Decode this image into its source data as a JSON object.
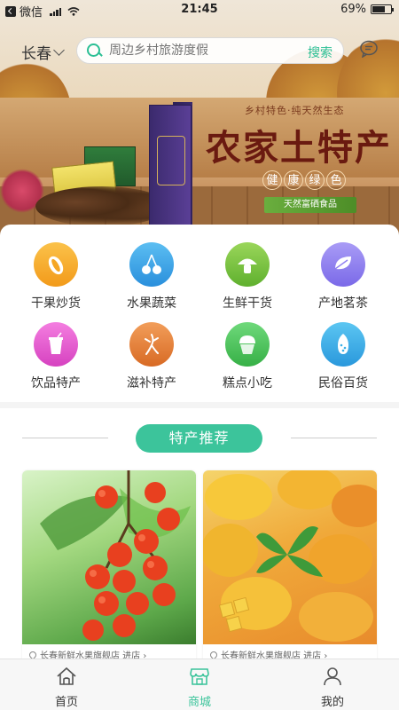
{
  "status_bar": {
    "carrier": "微信",
    "time": "21:45",
    "battery": "69%",
    "battery_level": 0.69
  },
  "header": {
    "city": "长春",
    "search_placeholder": "周边乡村旅游度假",
    "search_button": "搜索"
  },
  "banner": {
    "tagline": "乡村特色·纯天然生态",
    "title": "农家土特产",
    "subtitle_chars": [
      "健",
      "康",
      "绿",
      "色"
    ],
    "badge": "天然富硒食品"
  },
  "categories": [
    {
      "label": "干果炒货",
      "icon": "nuts-icon",
      "color": "#f5a623"
    },
    {
      "label": "水果蔬菜",
      "icon": "cherry-icon",
      "color": "#3aa3e8"
    },
    {
      "label": "生鲜干货",
      "icon": "mushroom-icon",
      "color": "#7cc43f"
    },
    {
      "label": "产地茗茶",
      "icon": "tea-leaf-icon",
      "color": "#8e7ef0"
    },
    {
      "label": "饮品特产",
      "icon": "drink-icon",
      "color": "#e85cd0"
    },
    {
      "label": "滋补特产",
      "icon": "ginseng-icon",
      "color": "#e8823a"
    },
    {
      "label": "糕点小吃",
      "icon": "cupcake-icon",
      "color": "#4cc45c"
    },
    {
      "label": "民俗百货",
      "icon": "gourd-icon",
      "color": "#3ab0e8"
    }
  ],
  "section": {
    "title": "特产推荐"
  },
  "products": [
    {
      "store": "长春新鲜水果旗舰店 进店 ›",
      "image": "cherries-photo"
    },
    {
      "store": "长春新鲜水果旗舰店 进店 ›",
      "image": "mangoes-photo"
    }
  ],
  "tabbar": [
    {
      "label": "首页",
      "icon": "home-icon",
      "active": false
    },
    {
      "label": "商城",
      "icon": "store-icon",
      "active": true
    },
    {
      "label": "我的",
      "icon": "user-icon",
      "active": false
    }
  ],
  "colors": {
    "accent": "#3cc49b",
    "search_accent": "#2bbf94"
  }
}
